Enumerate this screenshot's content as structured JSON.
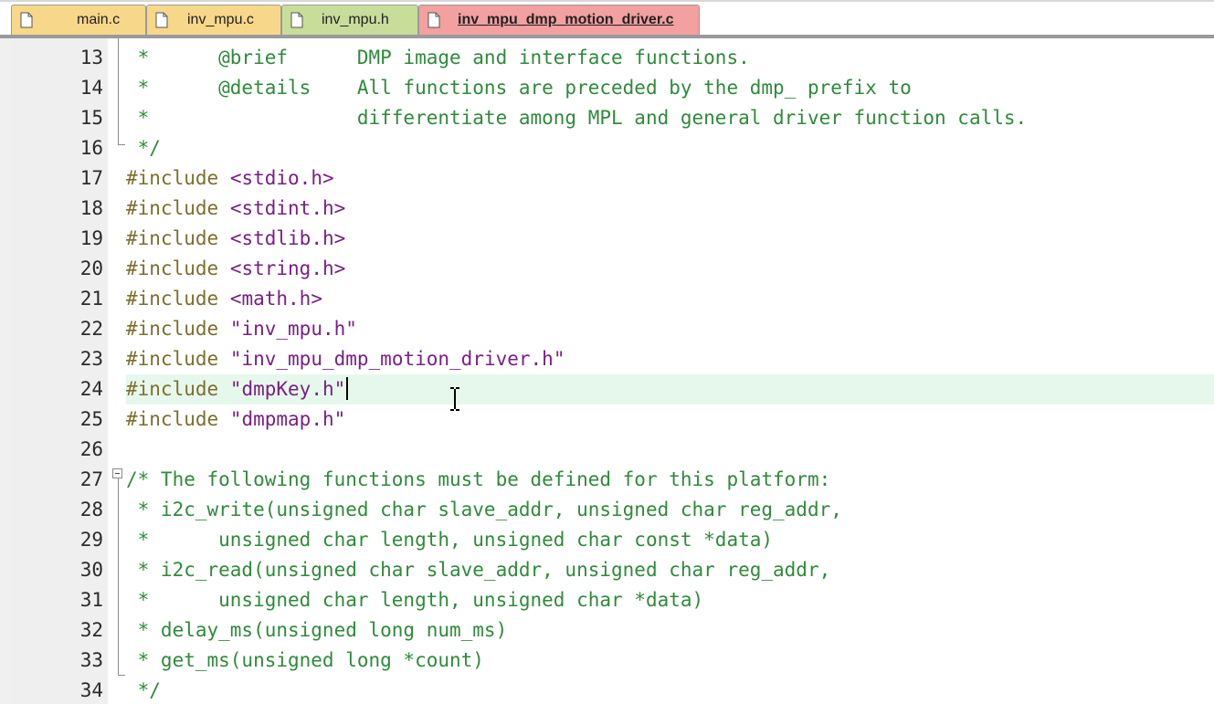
{
  "tabs": [
    {
      "label": "main.c",
      "active": false,
      "color": "#f7d78a"
    },
    {
      "label": "inv_mpu.c",
      "active": false,
      "color": "#f7d78a"
    },
    {
      "label": "inv_mpu.h",
      "active": false,
      "color": "#c9dd9a"
    },
    {
      "label": "inv_mpu_dmp_motion_driver.c",
      "active": true,
      "color": "#f3a0a0"
    }
  ],
  "editor": {
    "current_line": 24,
    "lines": [
      {
        "no": "13",
        "text": " *      @brief      DMP image and interface functions."
      },
      {
        "no": "14",
        "text": " *      @details    All functions are preceded by the dmp_ prefix to"
      },
      {
        "no": "15",
        "text": " *                  differentiate among MPL and general driver function calls."
      },
      {
        "no": "16",
        "text": " */"
      },
      {
        "no": "17",
        "text": "#include <stdio.h>"
      },
      {
        "no": "18",
        "text": "#include <stdint.h>"
      },
      {
        "no": "19",
        "text": "#include <stdlib.h>"
      },
      {
        "no": "20",
        "text": "#include <string.h>"
      },
      {
        "no": "21",
        "text": "#include <math.h>"
      },
      {
        "no": "22",
        "text": "#include \"inv_mpu.h\""
      },
      {
        "no": "23",
        "text": "#include \"inv_mpu_dmp_motion_driver.h\""
      },
      {
        "no": "24",
        "text": "#include \"dmpKey.h\""
      },
      {
        "no": "25",
        "text": "#include \"dmpmap.h\""
      },
      {
        "no": "26",
        "text": ""
      },
      {
        "no": "27",
        "text": "/* The following functions must be defined for this platform:"
      },
      {
        "no": "28",
        "text": " * i2c_write(unsigned char slave_addr, unsigned char reg_addr,"
      },
      {
        "no": "29",
        "text": " *      unsigned char length, unsigned char const *data)"
      },
      {
        "no": "30",
        "text": " * i2c_read(unsigned char slave_addr, unsigned char reg_addr,"
      },
      {
        "no": "31",
        "text": " *      unsigned char length, unsigned char *data)"
      },
      {
        "no": "32",
        "text": " * delay_ms(unsigned long num_ms)"
      },
      {
        "no": "33",
        "text": " * get_ms(unsigned long *count)"
      },
      {
        "no": "34",
        "text": " */"
      }
    ]
  },
  "colors": {
    "comment": "#2e8b3a",
    "preprocessor": "#7d6e2d",
    "include_path": "#7a1f86",
    "current_line_bg": "#e6f8ec"
  },
  "icons": {
    "tab_file": "file-icon",
    "fold_collapse": "minus-box-icon",
    "mouse": "text-cursor-icon"
  }
}
